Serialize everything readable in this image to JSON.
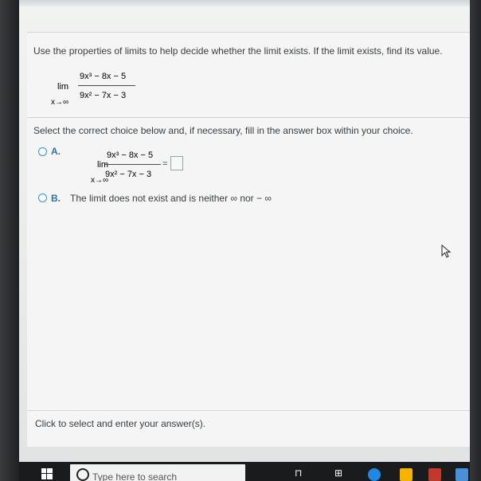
{
  "question": {
    "prompt": "Use the properties of limits to help decide whether the limit exists. If the limit exists, find its value.",
    "lim": "lim",
    "lim_sub": "x→∞",
    "numerator": "9x³ − 8x − 5",
    "denominator": "9x² − 7x − 3"
  },
  "instruction": "Select the correct choice below and, if necessary, fill in the answer box within your choice.",
  "option_a": {
    "letter": "A.",
    "lim": "lim",
    "lim_sub": "x→∞",
    "numerator": "9x³ − 8x − 5",
    "denominator": "9x² − 7x − 3",
    "equals": "="
  },
  "option_b": {
    "letter": "B.",
    "text": "The limit does not exist and is neither ∞ nor  − ∞"
  },
  "footer": "Click to select and enter your answer(s).",
  "taskbar": {
    "search_placeholder": "Type here to search",
    "windows_icon": "windows-logo-icon"
  },
  "colors": {
    "accent": "#3b8ed0",
    "option_letter": "#2f6fa8",
    "text": "#3a3d40"
  }
}
